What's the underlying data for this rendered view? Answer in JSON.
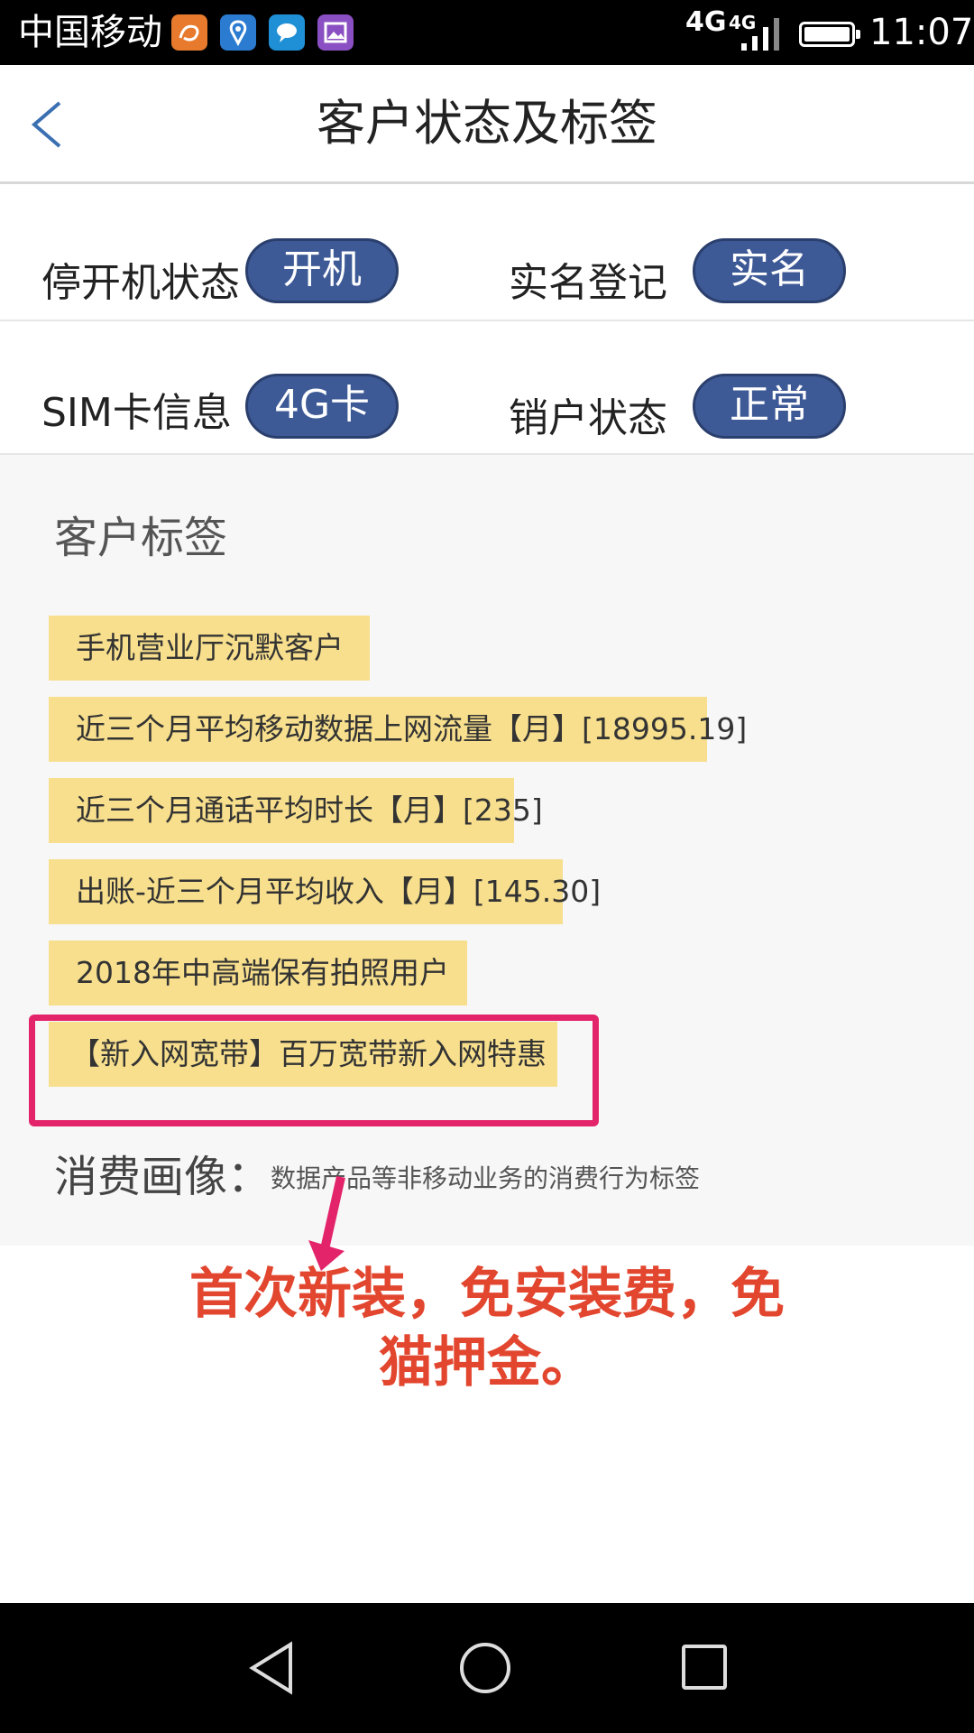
{
  "status_bar": {
    "carrier": "中国移动",
    "network_1": "4G",
    "network_2": "4G",
    "time": "11:07",
    "icons": [
      "uc-browser-icon",
      "location-icon",
      "message-icon",
      "gallery-icon"
    ]
  },
  "header": {
    "title": "客户状态及标签"
  },
  "status": {
    "power_label": "停开机状态",
    "power_value": "开机",
    "realname_label": "实名登记",
    "realname_value": "实名",
    "sim_label": "SIM卡信息",
    "sim_value": "4G卡",
    "account_label": "销户状态",
    "account_value": "正常"
  },
  "tags": {
    "heading": "客户标签",
    "items": [
      "手机营业厅沉默客户",
      "近三个月平均移动数据上网流量【月】[18995.19]",
      "近三个月通话平均时长【月】[235]",
      "出账-近三个月平均收入【月】[145.30]",
      "2018年中高端保有拍照用户",
      "【新入网宽带】百万宽带新入网特惠"
    ]
  },
  "consumption": {
    "label": "消费画像：",
    "description": "数据产品等非移动业务的消费行为标签"
  },
  "annotation": {
    "line1": "首次新装，免安装费，免",
    "line2": "猫押金。"
  },
  "colors": {
    "pill": "#3e5a96",
    "tag": "#f7df8d",
    "highlight": "#e3236a",
    "annotation": "#e2462f"
  }
}
